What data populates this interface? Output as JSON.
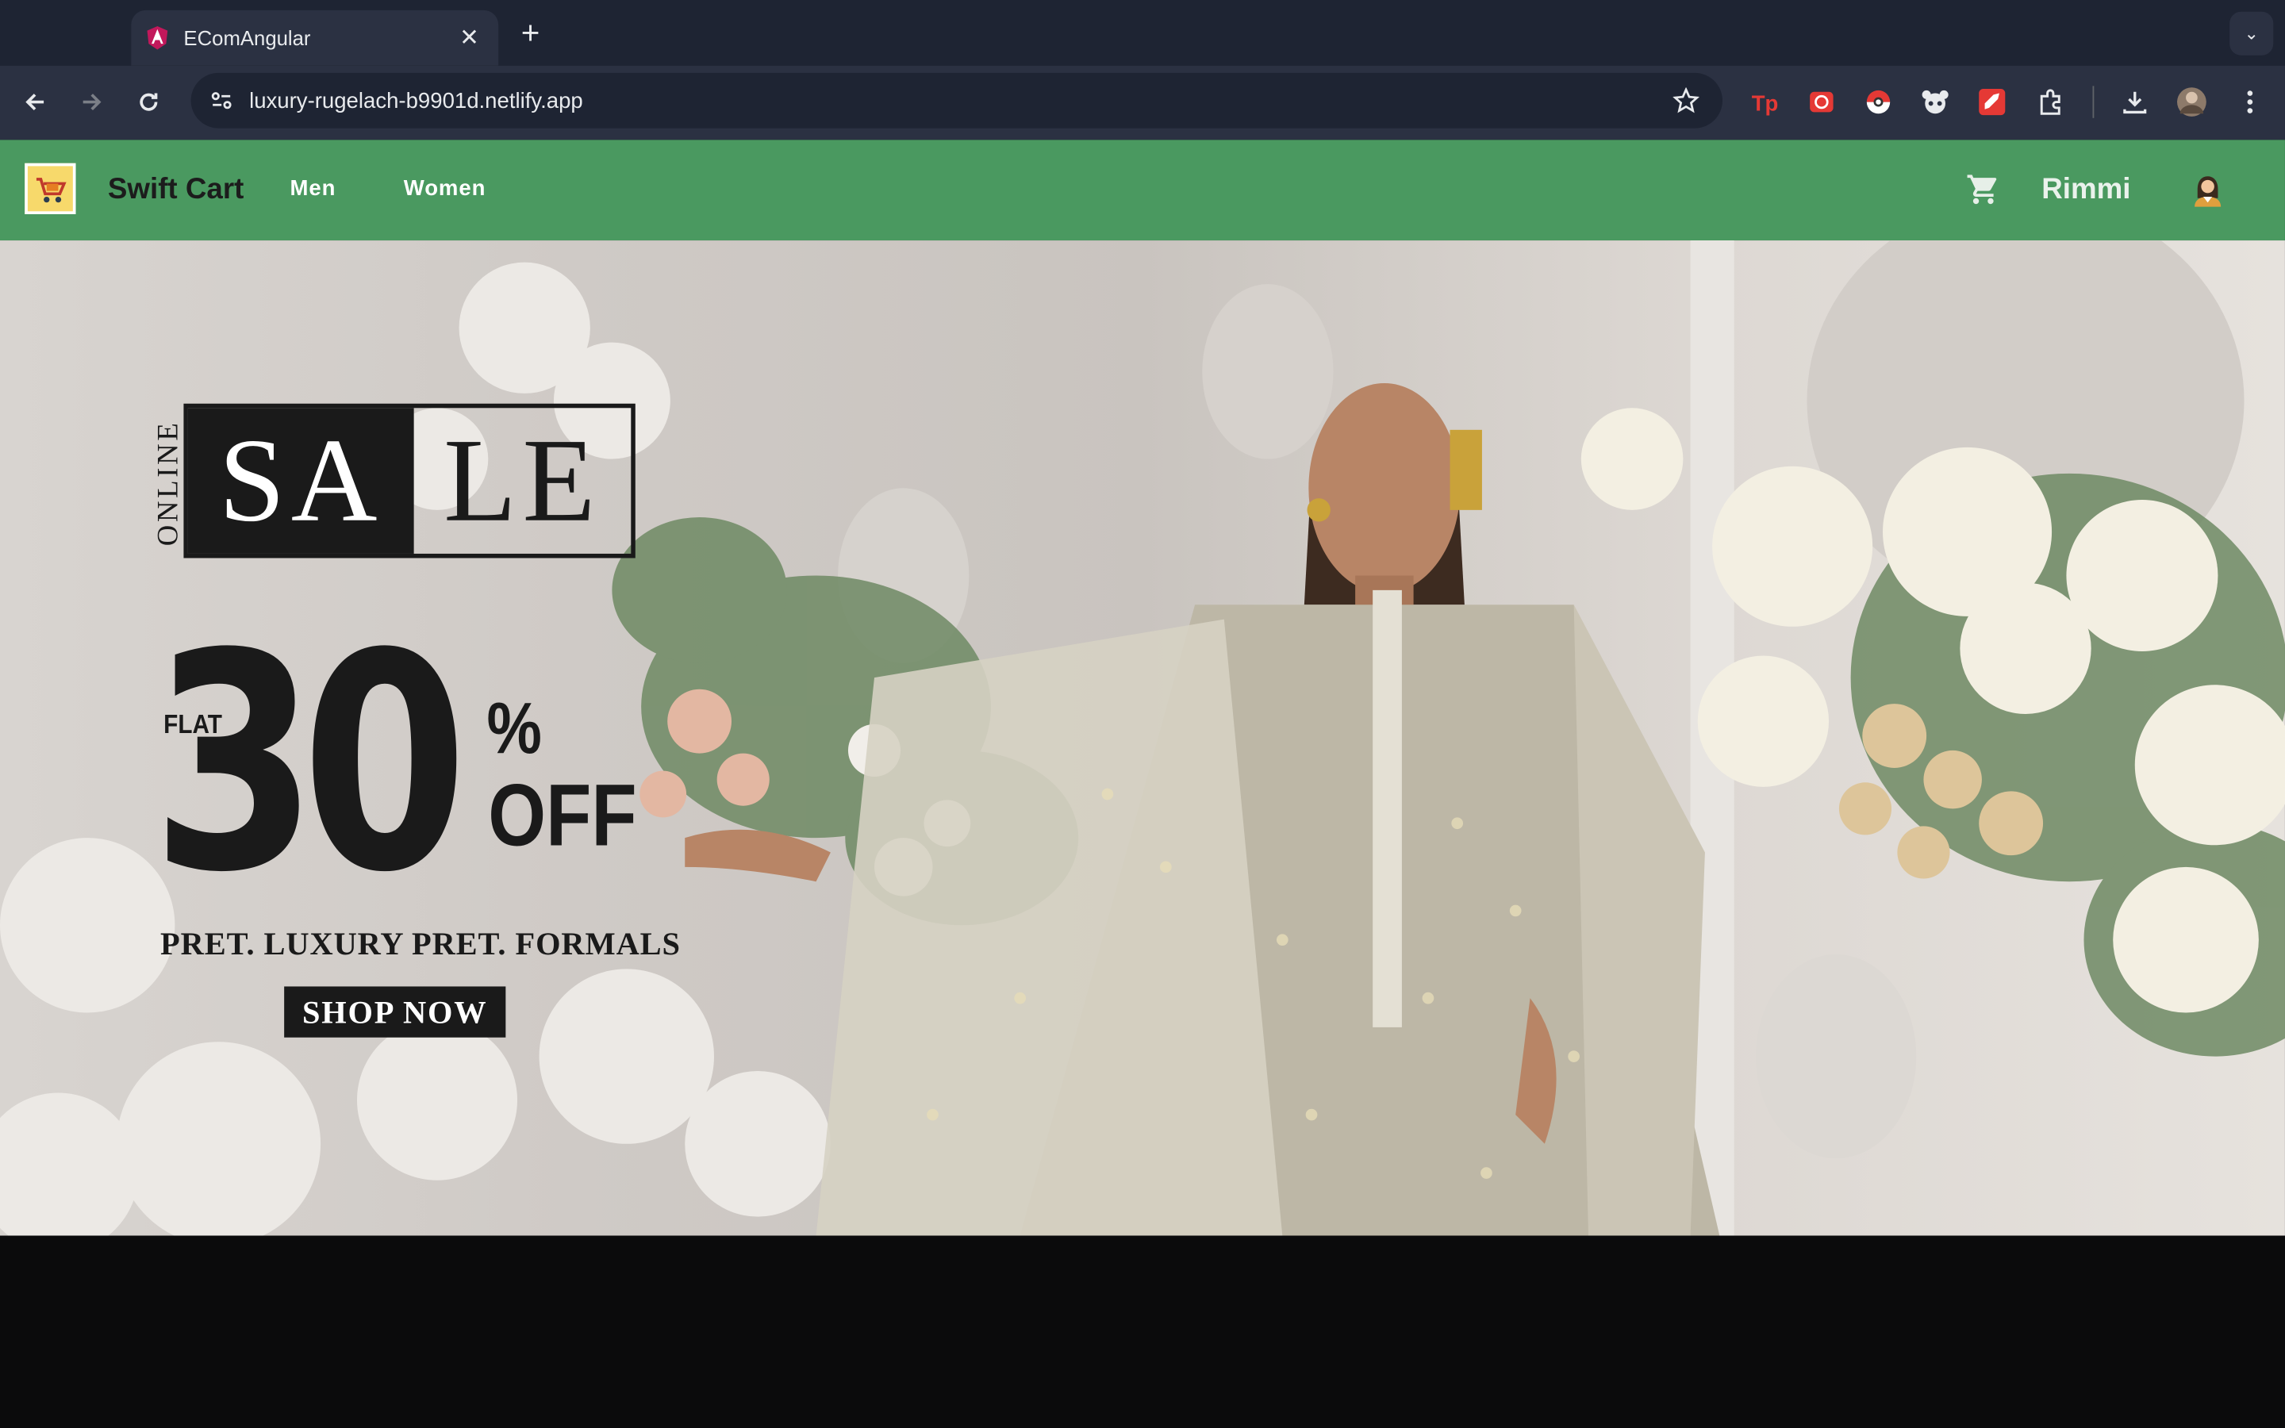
{
  "browser": {
    "tab_title": "EComAngular",
    "url": "luxury-rugelach-b9901d.netlify.app"
  },
  "header": {
    "brand": "Swift Cart",
    "nav": [
      "Men",
      "Women"
    ],
    "username": "Rimmi"
  },
  "hero": {
    "online_label": "ONLINE",
    "sale_left": "SA",
    "sale_right": "LE",
    "flat_label": "FLAT",
    "discount_number": "30",
    "percent_sign": "%",
    "off_label": "OFF",
    "tagline": "PRET. LUXURY PRET. FORMALS",
    "cta": "SHOP NOW"
  },
  "colors": {
    "header_bg": "#4a9960",
    "chrome_bg": "#2b3142"
  }
}
